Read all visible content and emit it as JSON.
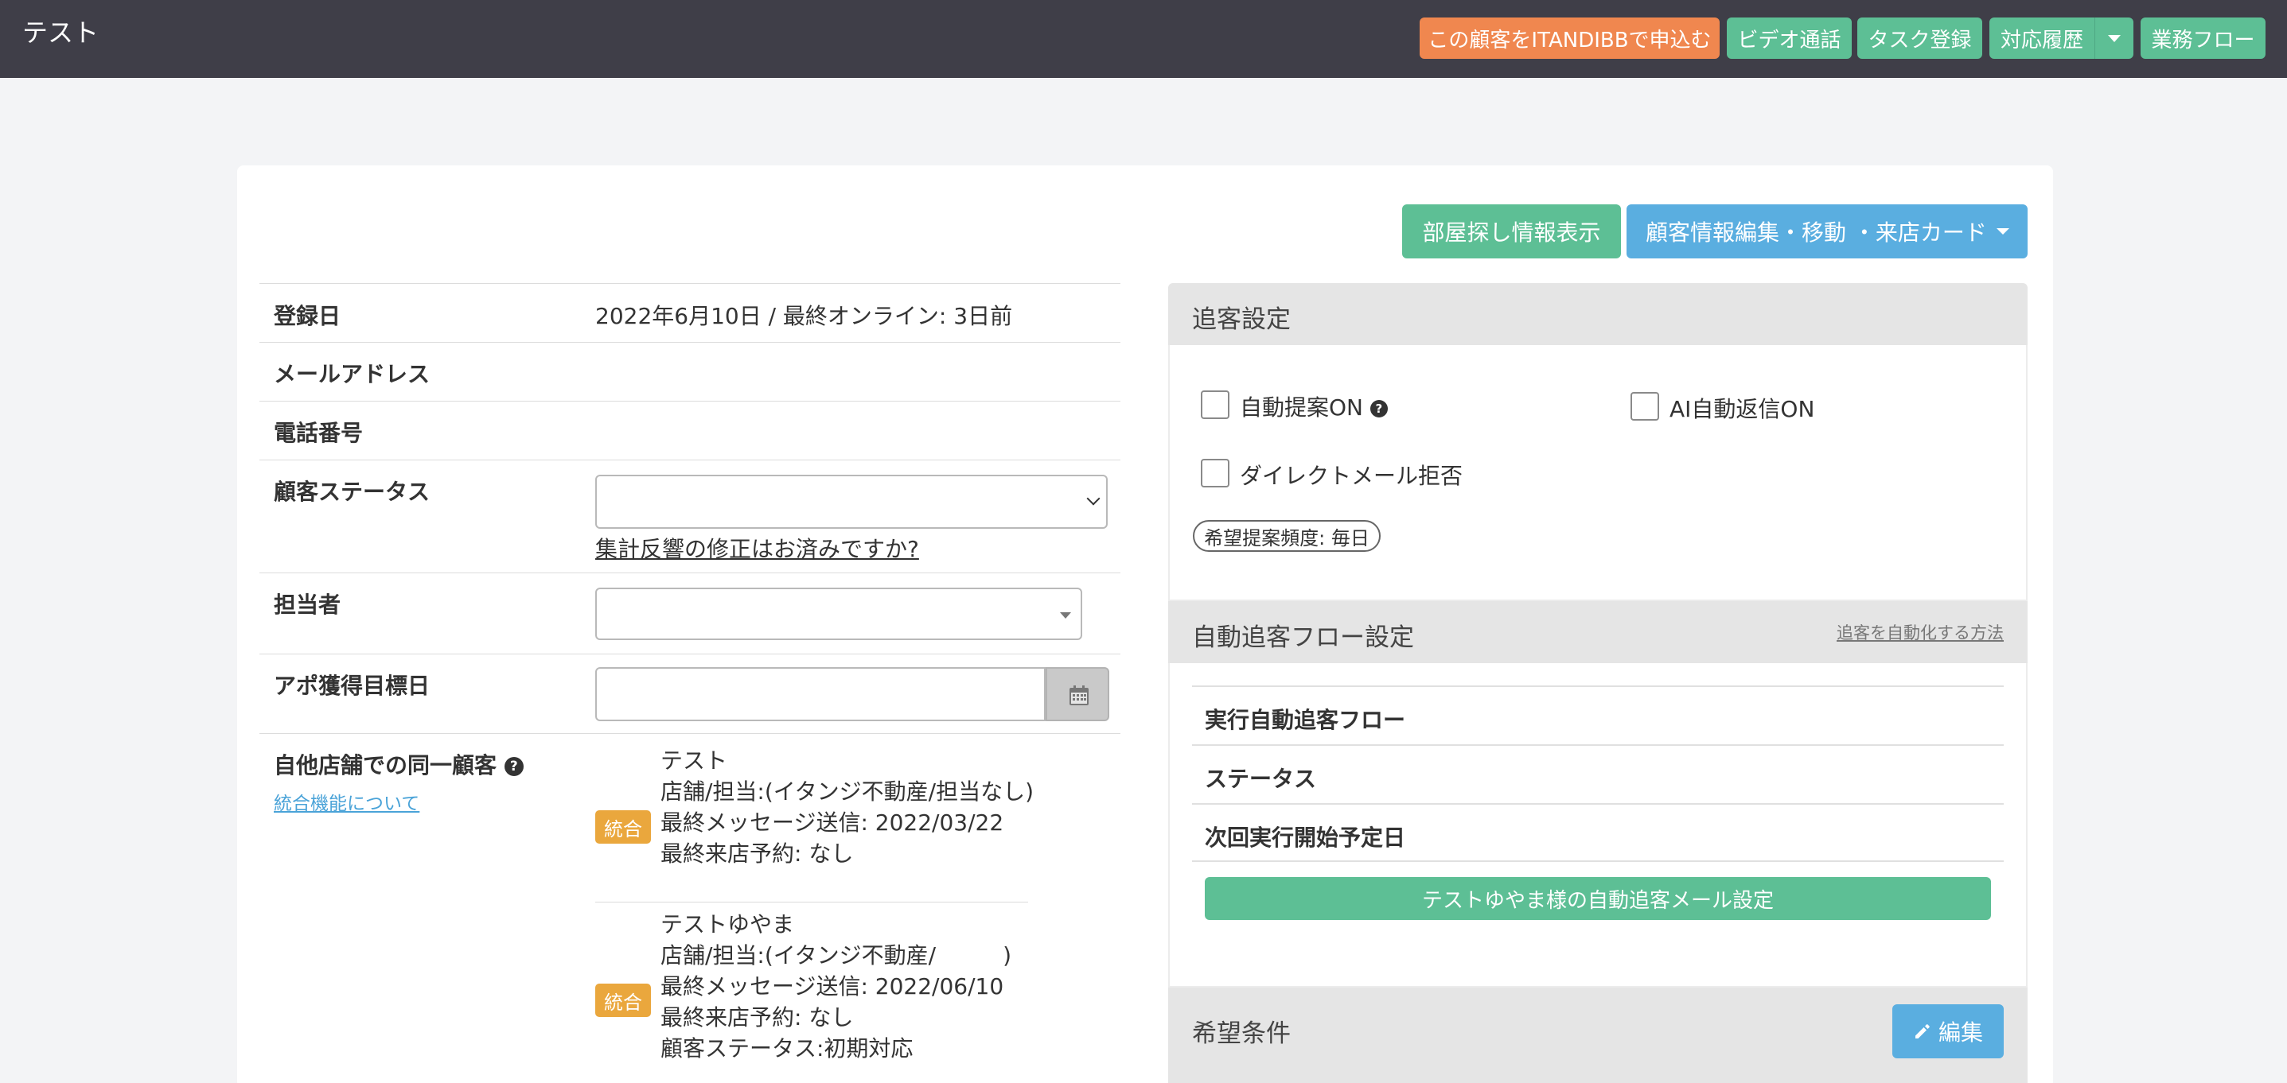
{
  "app": {
    "title": "テスト"
  },
  "topbar": {
    "itandi_label": "この顧客をITANDIBBで申込む",
    "video_label": "ビデオ通話",
    "task_label": "タスク登録",
    "history_label": "対応履歴",
    "workflow_label": "業務フロー"
  },
  "actions": {
    "room_search_label": "部屋探し情報表示",
    "edit_customer_label": "顧客情報編集・移動 ・来店カード"
  },
  "info": {
    "registered_label": "登録日",
    "registered_value": "2022年6月10日 / 最終オンライン: 3日前",
    "email_label": "メールアドレス",
    "email_value": "",
    "phone_label": "電話番号",
    "phone_value": "",
    "status_label": "顧客ステータス",
    "status_value": "",
    "status_link": "集計反響の修正はお済みですか?",
    "assignee_label": "担当者",
    "assignee_value": "",
    "appo_label": "アポ獲得目標日",
    "appo_value": "",
    "same_customer_label": "自他店舗での同一顧客",
    "merge_about_link": "統合機能について"
  },
  "same_customers": [
    {
      "merge_label": "統合",
      "lines": [
        "テスト",
        "店舗/担当:(イタンジ不動産/担当なし)",
        "最終メッセージ送信: 2022/03/22",
        "最終来店予約: なし"
      ]
    },
    {
      "merge_label": "統合",
      "lines": [
        "テストゆやま",
        "店舗/担当:(イタンジ不動産/　　　)",
        "最終メッセージ送信: 2022/06/10",
        "最終来店予約: なし",
        "顧客ステータス:初期対応"
      ]
    }
  ],
  "tracking": {
    "title": "追客設定",
    "auto_propose_label": "自動提案ON",
    "ai_reply_label": "AI自動返信ON",
    "dm_reject_label": "ダイレクトメール拒否",
    "frequency_label": "希望提案頻度: 毎日"
  },
  "auto_flow": {
    "title": "自動追客フロー設定",
    "howto_link": "追客を自動化する方法",
    "running_label": "実行自動追客フロー",
    "status_label": "ステータス",
    "next_date_label": "次回実行開始予定日",
    "mail_button_label": "テストゆやま様の自動追客メール設定"
  },
  "wish": {
    "title": "希望条件",
    "edit_label": "編集"
  },
  "colors": {
    "topbar": "#3f3e48",
    "orange": "#f0874f",
    "green": "#5dbf95",
    "blue": "#5aaee0",
    "merge_badge": "#eaa73d"
  },
  "icons": {
    "calendar": "calendar-icon",
    "question": "question-circle-icon",
    "pencil": "pencil-icon",
    "dropdown": "caret-down-icon"
  }
}
